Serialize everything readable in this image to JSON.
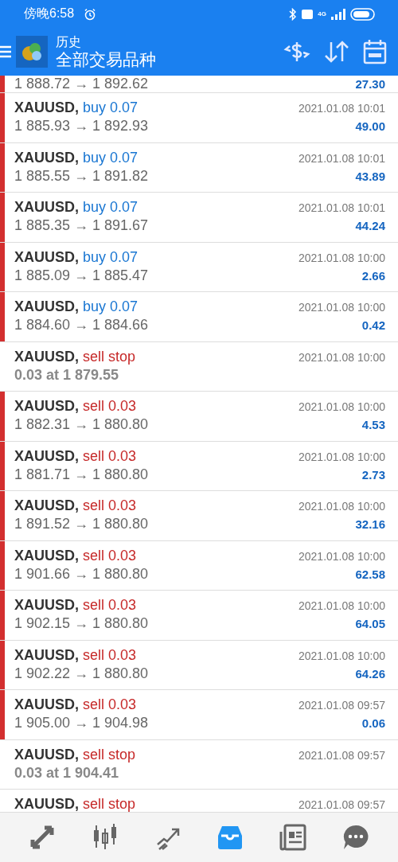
{
  "status_bar": {
    "time": "傍晚6:58",
    "network": "4G"
  },
  "app_bar": {
    "title": "历史",
    "subtitle": "全部交易品种"
  },
  "rows": [
    {
      "kind": "deal",
      "prices": "1 888.72 → 1 892.62",
      "profit": "27.30"
    },
    {
      "kind": "deal",
      "symbol": "XAUUSD,",
      "action": "buy 0.07",
      "color": "#1976d2",
      "prices": "1 885.93 → 1 892.93",
      "time": "2021.01.08 10:01",
      "profit": "49.00"
    },
    {
      "kind": "deal",
      "symbol": "XAUUSD,",
      "action": "buy 0.07",
      "color": "#1976d2",
      "prices": "1 885.55 → 1 891.82",
      "time": "2021.01.08 10:01",
      "profit": "43.89"
    },
    {
      "kind": "deal",
      "symbol": "XAUUSD,",
      "action": "buy 0.07",
      "color": "#1976d2",
      "prices": "1 885.35 → 1 891.67",
      "time": "2021.01.08 10:01",
      "profit": "44.24"
    },
    {
      "kind": "deal",
      "symbol": "XAUUSD,",
      "action": "buy 0.07",
      "color": "#1976d2",
      "prices": "1 885.09 → 1 885.47",
      "time": "2021.01.08 10:00",
      "profit": "2.66"
    },
    {
      "kind": "deal",
      "symbol": "XAUUSD,",
      "action": "buy 0.07",
      "color": "#1976d2",
      "prices": "1 884.60 → 1 884.66",
      "time": "2021.01.08 10:00",
      "profit": "0.42"
    },
    {
      "kind": "order",
      "symbol": "XAUUSD,",
      "action": "sell stop",
      "color": "#c62828",
      "prices": "0.03 at 1 879.55",
      "time": "2021.01.08 10:00"
    },
    {
      "kind": "deal",
      "symbol": "XAUUSD,",
      "action": "sell 0.03",
      "color": "#c62828",
      "prices": "1 882.31 → 1 880.80",
      "time": "2021.01.08 10:00",
      "profit": "4.53"
    },
    {
      "kind": "deal",
      "symbol": "XAUUSD,",
      "action": "sell 0.03",
      "color": "#c62828",
      "prices": "1 881.71 → 1 880.80",
      "time": "2021.01.08 10:00",
      "profit": "2.73"
    },
    {
      "kind": "deal",
      "symbol": "XAUUSD,",
      "action": "sell 0.03",
      "color": "#c62828",
      "prices": "1 891.52 → 1 880.80",
      "time": "2021.01.08 10:00",
      "profit": "32.16"
    },
    {
      "kind": "deal",
      "symbol": "XAUUSD,",
      "action": "sell 0.03",
      "color": "#c62828",
      "prices": "1 901.66 → 1 880.80",
      "time": "2021.01.08 10:00",
      "profit": "62.58"
    },
    {
      "kind": "deal",
      "symbol": "XAUUSD,",
      "action": "sell 0.03",
      "color": "#c62828",
      "prices": "1 902.15 → 1 880.80",
      "time": "2021.01.08 10:00",
      "profit": "64.05"
    },
    {
      "kind": "deal",
      "symbol": "XAUUSD,",
      "action": "sell 0.03",
      "color": "#c62828",
      "prices": "1 902.22 → 1 880.80",
      "time": "2021.01.08 10:00",
      "profit": "64.26"
    },
    {
      "kind": "deal",
      "symbol": "XAUUSD,",
      "action": "sell 0.03",
      "color": "#c62828",
      "prices": "1 905.00 → 1 904.98",
      "time": "2021.01.08 09:57",
      "profit": "0.06"
    },
    {
      "kind": "order",
      "symbol": "XAUUSD,",
      "action": "sell stop",
      "color": "#c62828",
      "prices": "0.03 at 1 904.41",
      "time": "2021.01.08 09:57"
    },
    {
      "kind": "order",
      "symbol": "XAUUSD,",
      "action": "sell stop",
      "color": "#c62828",
      "time": "2021.01.08 09:57"
    }
  ],
  "bottom_nav": [
    {
      "kind": "quotes",
      "selected": false
    },
    {
      "kind": "chart",
      "selected": false
    },
    {
      "kind": "trade",
      "selected": false
    },
    {
      "kind": "history",
      "selected": true
    },
    {
      "kind": "news",
      "selected": false
    },
    {
      "kind": "chat",
      "selected": false
    }
  ]
}
